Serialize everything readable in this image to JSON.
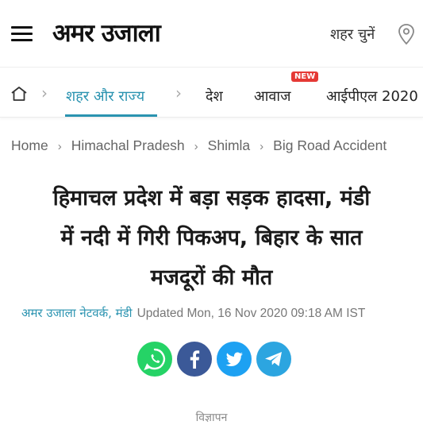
{
  "header": {
    "logo_text": "अमर उजाला",
    "city_picker_label": "शहर चुनें",
    "menu_icon": "hamburger-menu-icon",
    "location_icon": "location-pin-icon"
  },
  "nav": {
    "home_icon": "home-icon",
    "items": [
      {
        "label": "शहर और राज्य",
        "active": true
      },
      {
        "label": "देश",
        "active": false
      },
      {
        "label": "आवाज",
        "active": false,
        "badge": "NEW"
      },
      {
        "label": "आईपीएल 2020",
        "active": false
      }
    ]
  },
  "breadcrumb": {
    "items": [
      "Home",
      "Himachal Pradesh",
      "Shimla",
      "Big Road Accident"
    ]
  },
  "article": {
    "headline_lines": [
      "हिमाचल प्रदेश में बड़ा सड़क हादसा, मंडी",
      "में नदी में गिरी पिकअप, बिहार के सात",
      "मजदूरों की मौत"
    ],
    "author": "अमर उजाला नेटवर्क, मंडी",
    "updated": "Updated Mon, 16 Nov 2020 09:18 AM IST"
  },
  "share": {
    "buttons": [
      "whatsapp-icon",
      "facebook-icon",
      "twitter-icon",
      "telegram-icon"
    ]
  },
  "ad_label": "विज्ञापन",
  "colors": {
    "accent": "#2a93b0",
    "badge": "#e53935",
    "whatsapp": "#25d366",
    "facebook": "#3b5998",
    "twitter": "#1da1f2",
    "telegram": "#2ca5e0"
  }
}
